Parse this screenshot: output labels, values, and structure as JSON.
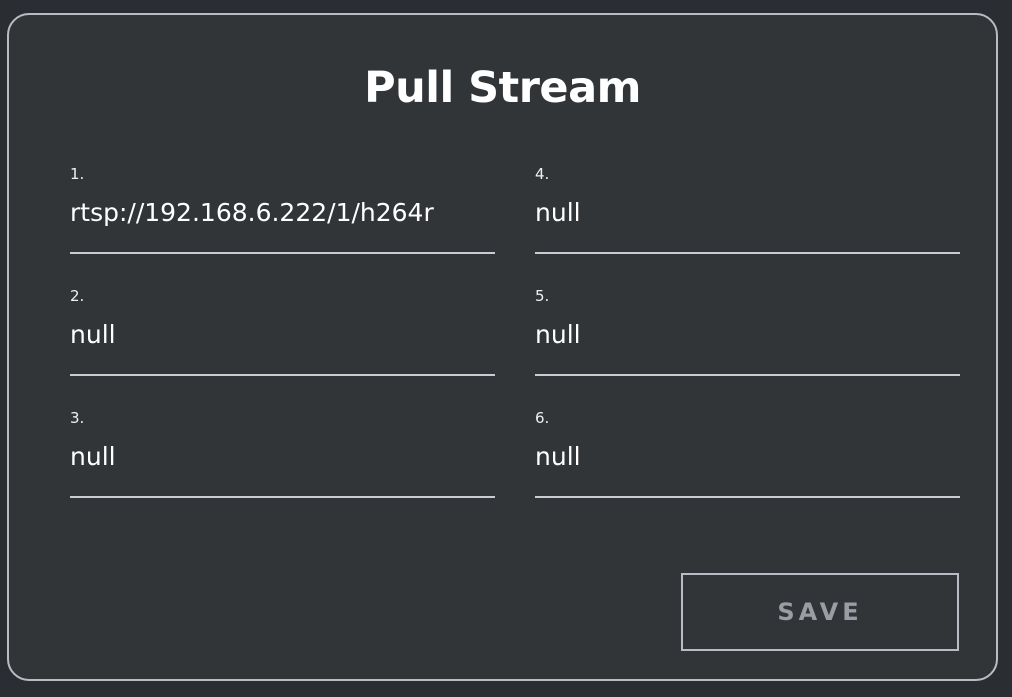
{
  "dialog": {
    "title": "Pull Stream",
    "fields": [
      {
        "label": "1.",
        "value": "rtsp://192.168.6.222/1/h264r"
      },
      {
        "label": "2.",
        "value": "null"
      },
      {
        "label": "3.",
        "value": "null"
      },
      {
        "label": "4.",
        "value": "null"
      },
      {
        "label": "5.",
        "value": "null"
      },
      {
        "label": "6.",
        "value": "null"
      }
    ],
    "save_label": "SAVE"
  },
  "colors": {
    "background": "#2a2d31",
    "dialog_background": "#323538",
    "border": "#b9bcc4",
    "text": "#ffffff",
    "button_text": "#9a9da3"
  }
}
